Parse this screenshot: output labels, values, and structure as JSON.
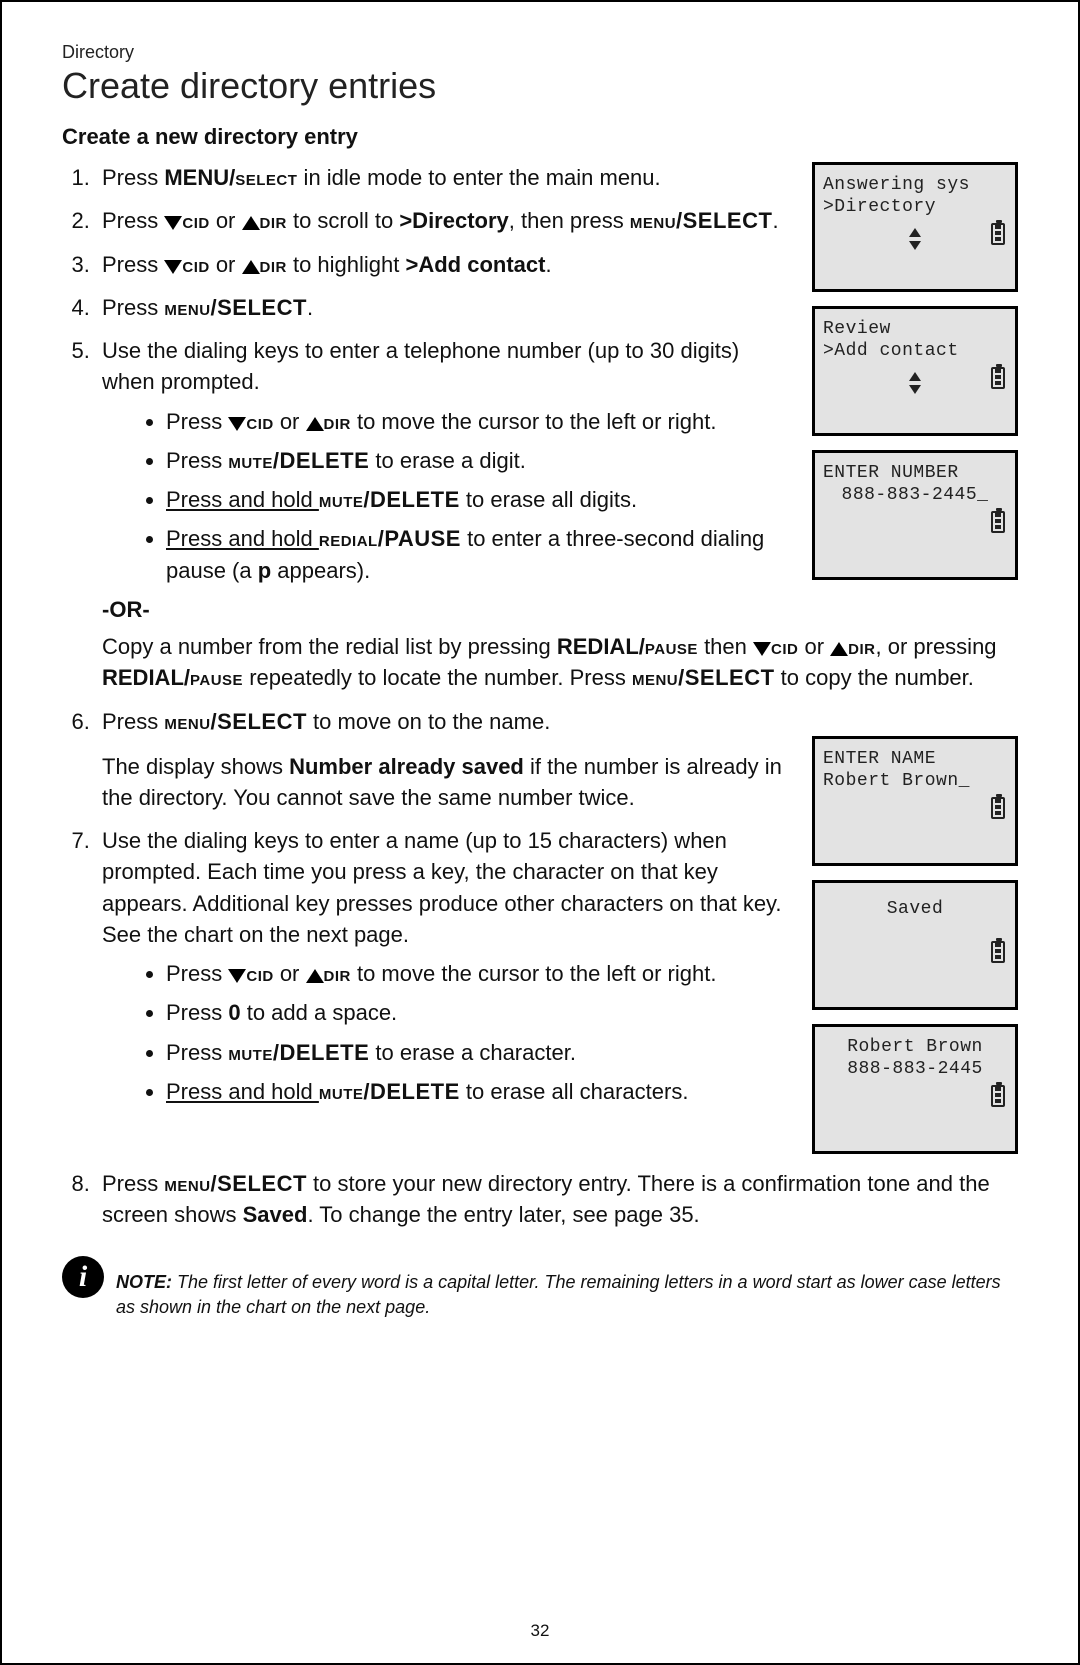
{
  "breadcrumb": "Directory",
  "title": "Create directory entries",
  "section": "Create a new directory entry",
  "steps": {
    "s1_a": "Press ",
    "s1_key": "MENU/",
    "s1_key2": "select",
    "s1_b": " in idle mode to enter the main menu.",
    "s2_a": "Press ",
    "s2_cid": "cid",
    "s2_or": " or ",
    "s2_dir": "dir",
    "s2_b": " to scroll to ",
    "s2_tgt": ">Directory",
    "s2_c": ", then press ",
    "s2_key": "menu/SELECT",
    "s2_d": ".",
    "s3_a": "Press ",
    "s3_b": " to highlight ",
    "s3_tgt": ">Add contact",
    "s3_c": ".",
    "s4_a": "Press ",
    "s4_key": "menu/SELECT",
    "s4_b": ".",
    "s5": "Use the dialing keys to enter a telephone number (up to 30 digits) when prompted.",
    "s5b1_a": "Press ",
    "s5b1_b": " to move the cursor to the left or right.",
    "s5b2_a": "Press ",
    "s5b2_key": "mute/DELETE",
    "s5b2_b": " to erase a digit.",
    "s5b3_a": "Press and hold ",
    "s5b3_key": "mute/DELETE",
    "s5b3_b": " to erase all digits.",
    "s5b4_a": "Press and hold ",
    "s5b4_key": "redial/PAUSE",
    "s5b4_b": " to enter a three-second dialing pause (a ",
    "s5b4_p": "p",
    "s5b4_c": " appears).",
    "or": "-OR-",
    "s5copy_a": "Copy a number from the redial list by pressing ",
    "s5copy_key1": "REDIAL/",
    "s5copy_key1b": "pause",
    "s5copy_b": " then ",
    "s5copy_c": ", or pressing ",
    "s5copy_key2": "REDIAL/",
    "s5copy_key2b": "pause",
    "s5copy_d": " repeatedly to locate the number. Press ",
    "s5copy_key3": "menu/SELECT",
    "s5copy_e": " to copy the number.",
    "s6_a": "Press ",
    "s6_key": "menu/SELECT",
    "s6_b": " to move on to the name.",
    "s6p_a": "The display shows ",
    "s6p_k": "Number already saved",
    "s6p_b": " if the number is already in the directory. You cannot save the same number twice.",
    "s7": "Use the dialing keys to enter a name (up to 15 characters) when prompted. Each time you press a key, the character on that key appears. Additional key presses produce other characters on that key. See the chart on the next page.",
    "s7b1_a": "Press ",
    "s7b1_b": " to move the cursor to the left or right.",
    "s7b2_a": "Press ",
    "s7b2_k": "0",
    "s7b2_b": " to add a space.",
    "s7b3_a": "Press ",
    "s7b3_key": "mute/DELETE",
    "s7b3_b": " to erase a character.",
    "s7b4_a": "Press and hold ",
    "s7b4_key": "mute/DELETE",
    "s7b4_b": " to erase all characters.",
    "s8_a": "Press ",
    "s8_key": "menu/SELECT",
    "s8_b": " to store your new directory entry. There is a confirmation tone and the screen shows ",
    "s8_k": "Saved",
    "s8_c": ". To change the entry later, see page 35."
  },
  "note": {
    "label": "NOTE:",
    "text": " The first letter of every word is a capital letter. The remaining letters in a word start as lower case letters as shown in the chart on the next page."
  },
  "lcd": {
    "a1": "Answering sys",
    "a2": ">Directory",
    "b1": " Review",
    "b2": ">Add contact",
    "c1": "ENTER NUMBER",
    "c2": "888-883-2445_",
    "d1": "ENTER NAME",
    "d2": "Robert Brown_",
    "e1": "Saved",
    "f1": "Robert Brown",
    "f2": "888-883-2445"
  },
  "pageNumber": "32"
}
